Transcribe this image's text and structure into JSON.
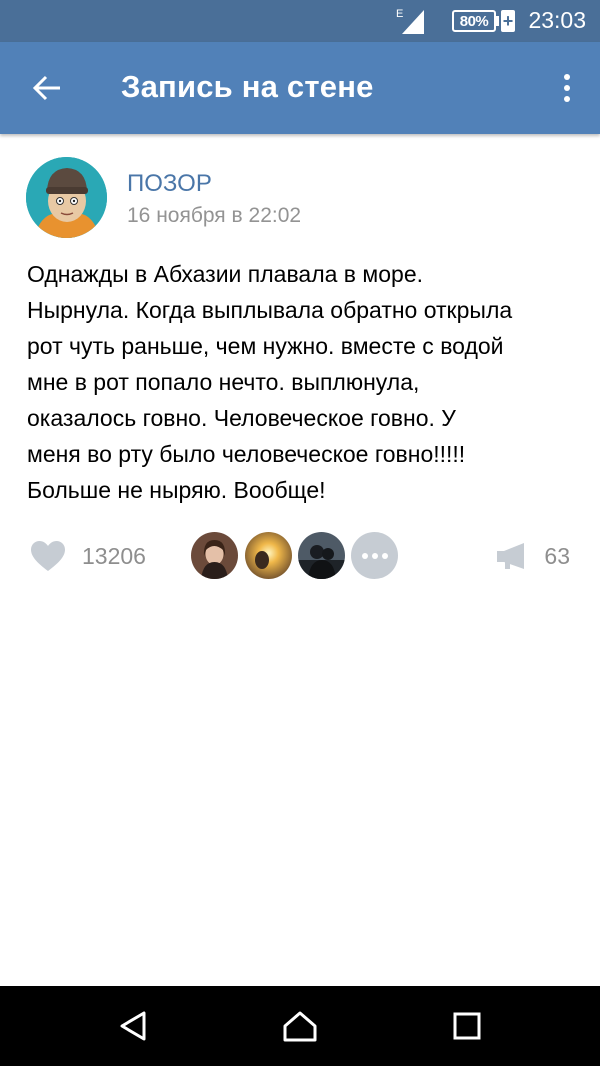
{
  "status_bar": {
    "network_label": "E",
    "battery_percent": "80%",
    "battery_charging_symbol": "+",
    "time": "23:03"
  },
  "app_bar": {
    "title": "Запись на стене",
    "back_icon": "arrow-left-icon",
    "more_icon": "more-vertical-icon"
  },
  "post": {
    "author": "ПОЗОР",
    "date": "16 ноября в 22:02",
    "text": "Однажды в Абхазии плавала в море.\nНырнула. Когда выплывала обратно открыла\nрот чуть раньше, чем нужно. вместе с водой\nмне в рот попало нечто. выплюнула,\nоказалось говно. Человеческое говно. У\nменя во рту было человеческое говно!!!!!\nБольше не ныряю. Вообще!"
  },
  "actions": {
    "likes": "13206",
    "shares": "63",
    "like_icon": "heart-icon",
    "share_icon": "megaphone-icon",
    "more_likers_icon": "more-horizontal-icon"
  },
  "nav_bar": {
    "back_icon": "nav-back-triangle-icon",
    "home_icon": "nav-home-icon",
    "recents_icon": "nav-recents-square-icon"
  },
  "colors": {
    "status_bar": "#4a6f98",
    "app_bar": "#5181b8",
    "link": "#4a76a8",
    "secondary_text": "#939393",
    "icon_gray": "#c6ccd3"
  }
}
